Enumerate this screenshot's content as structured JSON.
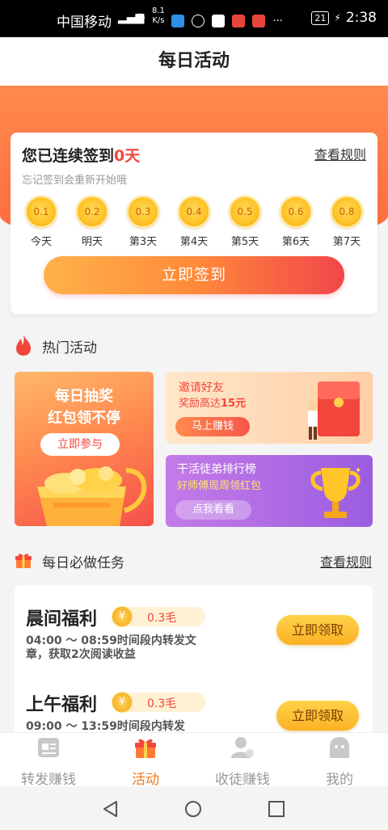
{
  "status": {
    "carrier": "中国移动",
    "speed_top": "8.1",
    "speed_bottom": "K/s",
    "battery": "21",
    "time": "2:38",
    "more": "···"
  },
  "header": {
    "title": "每日活动"
  },
  "sign": {
    "title_prefix": "您已连续签到",
    "days": "0天",
    "rule": "查看规则",
    "subtitle": "忘记签到会重新开始哦",
    "rewards": [
      {
        "value": "0.1",
        "label": "今天"
      },
      {
        "value": "0.2",
        "label": "明天"
      },
      {
        "value": "0.3",
        "label": "第3天"
      },
      {
        "value": "0.4",
        "label": "第4天"
      },
      {
        "value": "0.5",
        "label": "第5天"
      },
      {
        "value": "0.6",
        "label": "第6天"
      },
      {
        "value": "0.8",
        "label": "第7天"
      }
    ],
    "button": "立即签到"
  },
  "hot": {
    "title": "热门活动",
    "lottery": {
      "line1": "每日抽奖",
      "line2": "红包领不停",
      "button": "立即参与"
    },
    "invite": {
      "line1": "邀请好友",
      "line2_prefix": "奖励高达",
      "amount": "15元",
      "button": "马上赚钱"
    },
    "rank": {
      "line1": "干活徒弟排行榜",
      "line2": "好师傅周周领红包",
      "button": "点我看看"
    }
  },
  "tasks": {
    "title": "每日必做任务",
    "rule": "查看规则",
    "items": [
      {
        "name": "晨间福利",
        "amount": "0.3毛",
        "desc": "04:00 ～ 08:59时间段内转发文章，获取2次阅读收益",
        "button": "立即领取",
        "yen": "¥"
      },
      {
        "name": "上午福利",
        "amount": "0.3毛",
        "desc": "09:00 ～ 13:59时间段内转发",
        "button": "立即领取",
        "yen": "¥"
      }
    ]
  },
  "tabs": [
    {
      "label": "转发赚钱",
      "active": false
    },
    {
      "label": "活动",
      "active": true
    },
    {
      "label": "收徒赚钱",
      "active": false
    },
    {
      "label": "我的",
      "active": false
    }
  ],
  "colors": {
    "accent": "#f27a1e",
    "red": "#f2463d",
    "banner": "#ff7a45"
  }
}
